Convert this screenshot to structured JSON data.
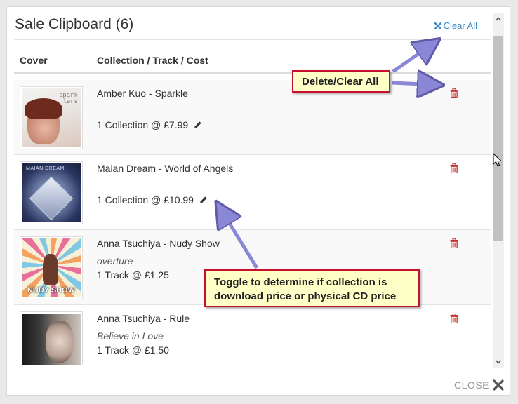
{
  "modal": {
    "title": "Sale Clipboard (6)",
    "clear_all_label": "Clear All",
    "close_label": "CLOSE"
  },
  "columns": {
    "cover": "Cover",
    "details": "Collection / Track / Cost"
  },
  "items": [
    {
      "title": "Amber Kuo - Sparkle",
      "subtitle": "",
      "price": "1 Collection @ £7.99",
      "editable": true,
      "cover_text": "spark lers"
    },
    {
      "title": "Maian Dream - World of Angels",
      "subtitle": "",
      "price": "1 Collection @ £10.99",
      "editable": true,
      "cover_text": "MAIAN DREAM"
    },
    {
      "title": "Anna Tsuchiya - Nudy Show",
      "subtitle": "overture",
      "price": "1 Track @ £1.25",
      "editable": false,
      "cover_text": "NUDY SHOW"
    },
    {
      "title": "Anna Tsuchiya - Rule",
      "subtitle": "Believe in Love",
      "price": "1 Track @ £1.50",
      "editable": false,
      "cover_text": ""
    }
  ],
  "annotations": {
    "delete_callout": "Delete/Clear All",
    "toggle_callout": "Toggle to determine if collection is download price or physical CD price"
  },
  "colors": {
    "link": "#3a87c8",
    "trash": "#c9302c",
    "callout_bg": "#ffffc8",
    "callout_border": "#c8102e",
    "arrow": "#7b78c8"
  }
}
